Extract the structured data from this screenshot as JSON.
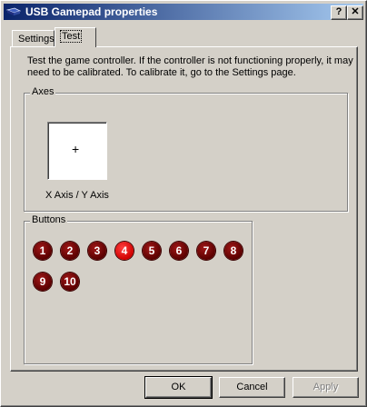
{
  "window": {
    "title": "USB Gamepad  properties",
    "help_label": "?",
    "close_label": "✕"
  },
  "tabs": [
    {
      "label": "Settings",
      "selected": false
    },
    {
      "label": "Test",
      "selected": true
    }
  ],
  "description": "Test the game controller.  If the controller is not functioning properly, it may need to be calibrated.  To calibrate it, go to the Settings page.",
  "axes": {
    "group_label": "Axes",
    "crosshair": "+",
    "label": "X Axis / Y Axis"
  },
  "buttons_group": {
    "label": "Buttons",
    "buttons": [
      {
        "label": "1",
        "pressed": false
      },
      {
        "label": "2",
        "pressed": false
      },
      {
        "label": "3",
        "pressed": false
      },
      {
        "label": "4",
        "pressed": true
      },
      {
        "label": "5",
        "pressed": false
      },
      {
        "label": "6",
        "pressed": false
      },
      {
        "label": "7",
        "pressed": false
      },
      {
        "label": "8",
        "pressed": false
      },
      {
        "label": "9",
        "pressed": false
      },
      {
        "label": "10",
        "pressed": false
      }
    ]
  },
  "dialog_buttons": {
    "ok": "OK",
    "cancel": "Cancel",
    "apply": "Apply",
    "apply_enabled": false
  }
}
